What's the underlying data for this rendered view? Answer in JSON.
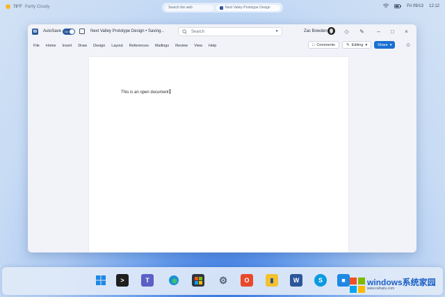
{
  "desktop": {
    "weather": {
      "temp": "78°F",
      "condition": "Partly Cloudy"
    },
    "search_pill": {
      "left_text": "Search the web",
      "right_text": "Next Valley Prototype Design"
    },
    "system": {
      "date": "Fri 09/13",
      "time": "12:12"
    }
  },
  "word": {
    "autosave_label": "AutoSave",
    "toggle_state": "On",
    "doc_title": "Next Valley Prototype Design • Saving...",
    "search_placeholder": "Search",
    "user_name": "Zac Bowden",
    "menu": [
      "File",
      "Home",
      "Insert",
      "Draw",
      "Design",
      "Layout",
      "References",
      "Mailings",
      "Review",
      "View",
      "Help"
    ],
    "comments_label": "Comments",
    "editing_label": "Editing",
    "share_label": "Share",
    "document_text": "This is an open document"
  },
  "taskbar": {
    "icons": [
      "start-icon",
      "terminal-icon",
      "teams-icon",
      "edge-icon",
      "store-icon",
      "settings-icon",
      "office-icon",
      "file-explorer-icon",
      "word-icon",
      "skype-icon",
      "cube-icon"
    ]
  },
  "watermark": {
    "brand": "windows系统家园",
    "url": "www.ruihaitu.com"
  },
  "colors": {
    "word_blue": "#2b579a",
    "share_blue": "#1b6fd1",
    "desktop_blue": "#2f6fe0"
  }
}
